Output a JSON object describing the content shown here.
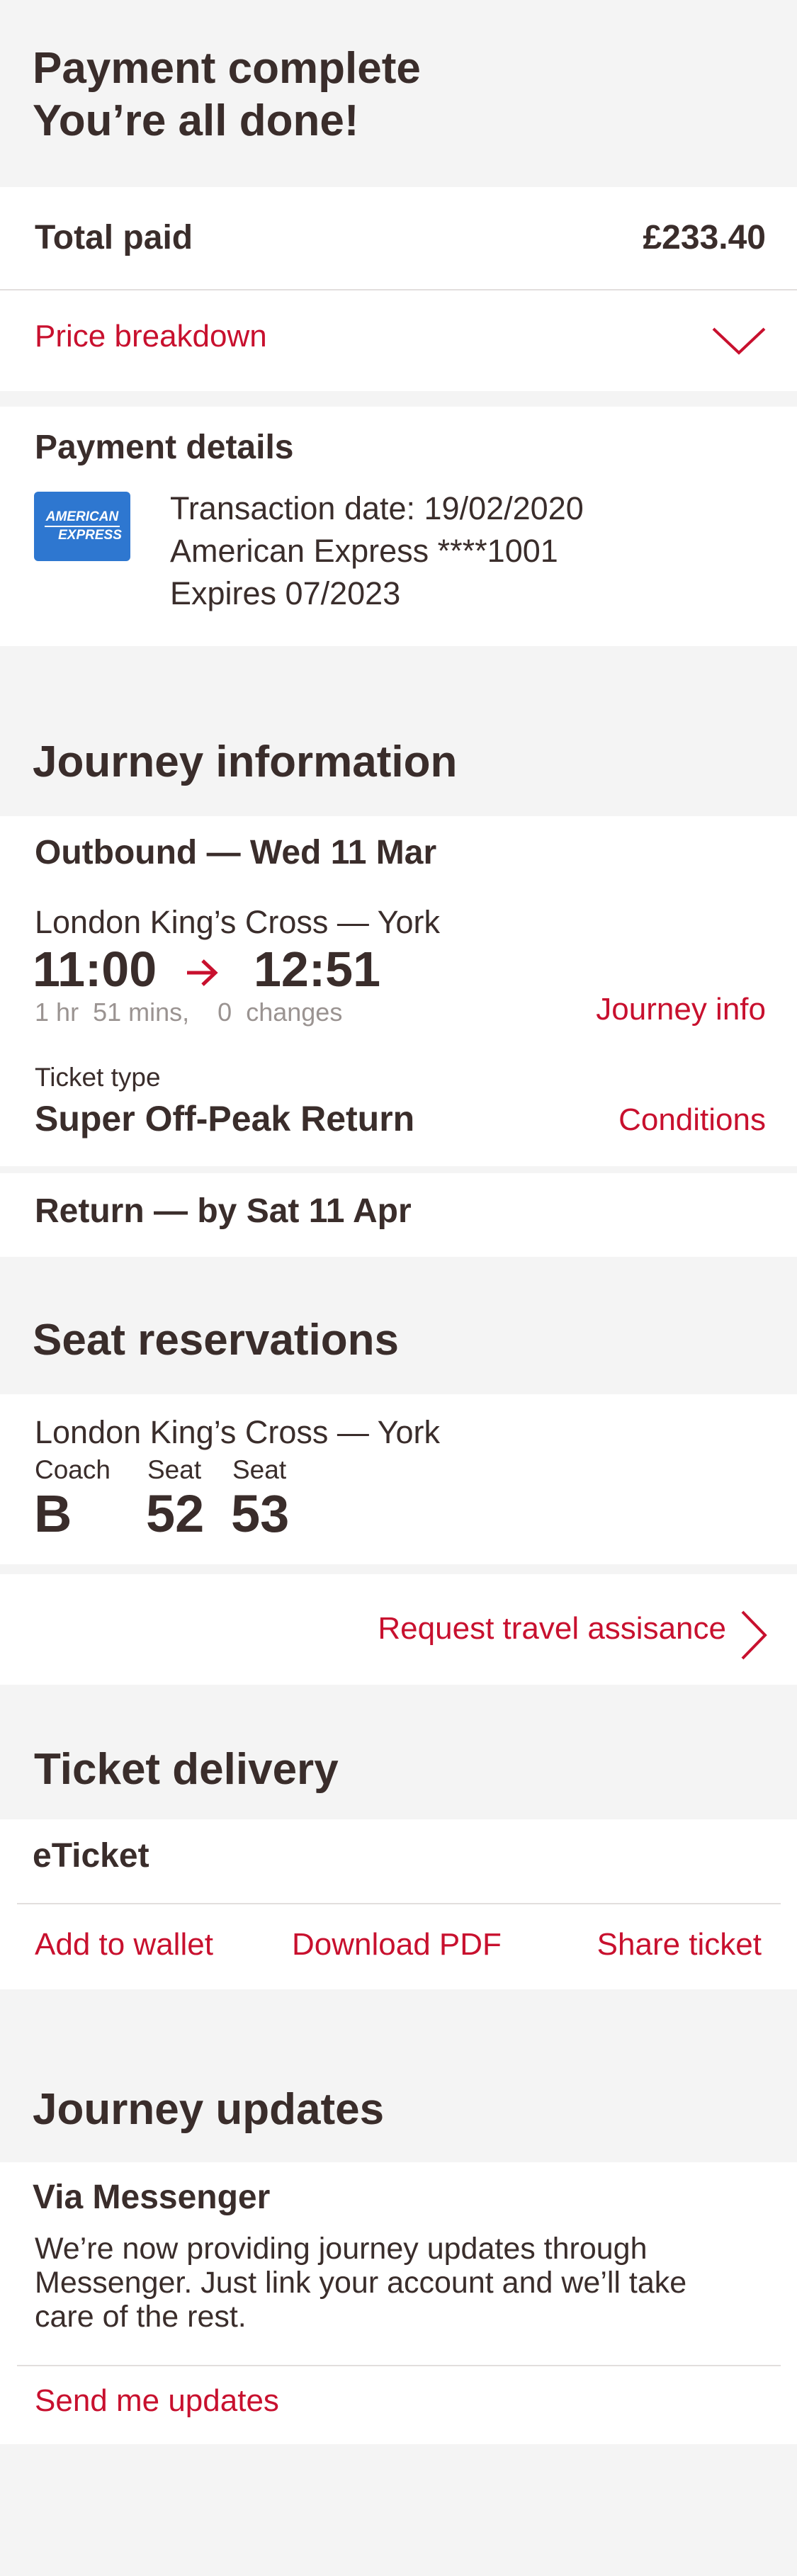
{
  "header": {
    "line1": "Payment complete",
    "line2": "You’re all done!"
  },
  "total": {
    "label": "Total paid",
    "amount": "£233.40"
  },
  "price_breakdown": {
    "label": "Price breakdown",
    "icon": "chevron-down-icon"
  },
  "payment": {
    "title": "Payment details",
    "card_logo_line1": "AMERICAN",
    "card_logo_line2": "EXPRESS",
    "transaction": "Transaction date: 19/02/2020",
    "card": "American Express ****1001",
    "expires": "Expires 07/2023"
  },
  "journey": {
    "title": "Journey information",
    "outbound_title": "Outbound — Wed 11 Mar",
    "route": "London King’s Cross — York",
    "depart": "11:00",
    "arrive": "12:51",
    "arrow_icon": "arrow-right-icon",
    "dur_hr_num": "1",
    "dur_hr_label": "hr",
    "dur_min_num": "51",
    "dur_min_label": "mins,",
    "changes_num": "0",
    "changes_label": "changes",
    "journey_info_link": "Journey info",
    "ticket_type_label": "Ticket type",
    "ticket_type": "Super Off-Peak Return",
    "conditions_link": "Conditions",
    "return_title": "Return — by Sat 11 Apr"
  },
  "seats": {
    "title": "Seat reservations",
    "route": "London King’s Cross — York",
    "coach_label": "Coach",
    "coach": "B",
    "seat1_label": "Seat",
    "seat1": "52",
    "seat2_label": "Seat",
    "seat2": "53",
    "assistance_link": "Request travel assisance",
    "assistance_icon": "chevron-right-icon"
  },
  "delivery": {
    "title": "Ticket delivery",
    "type": "eTicket",
    "add_wallet": "Add to wallet",
    "download_pdf": "Download PDF",
    "share": "Share ticket"
  },
  "updates": {
    "title": "Journey updates",
    "via": "Via Messenger",
    "line1": "We’re now providing journey updates through",
    "line2": "Messenger. Just link your account and we’ll take",
    "line3": "care of the rest.",
    "send_link": "Send me updates"
  },
  "colors": {
    "accent": "#c8102e",
    "text": "#3a2d2b",
    "background": "#f4f4f4",
    "amex_blue": "#2e77d0"
  }
}
